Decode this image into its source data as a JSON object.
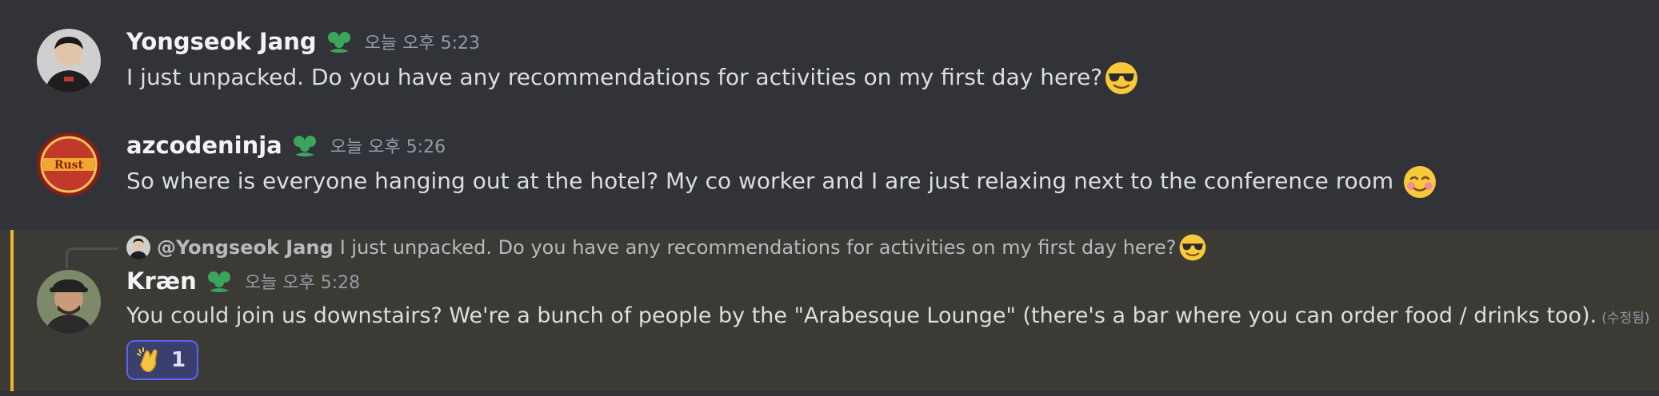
{
  "messages": [
    {
      "author": "Yongseok Jang",
      "timestamp": "오늘 오후 5:23",
      "text": "I just unpacked. Do you have any recommendations for activities on my first day here?",
      "emoji": "sunglasses-emoji"
    },
    {
      "author": "azcodeninja",
      "timestamp": "오늘 오후 5:26",
      "text": "So where is everyone hanging out at the hotel? My co worker and I are just relaxing next to the conference room ",
      "emoji": "smiling-face-emoji"
    },
    {
      "reply": {
        "author": "@Yongseok Jang",
        "text": "I just unpacked. Do you have any recommendations for activities on my first day here?",
        "emoji": "sunglasses-emoji"
      },
      "author": "Kræn",
      "timestamp": "오늘 오후 5:28",
      "text": "You could join us downstairs? We're a bunch of people by the \"Arabesque Lounge\" (there's a bar where you can order food / drinks too).",
      "edited": "(수정됨)",
      "reaction": {
        "emoji": "clapping-hands-emoji",
        "count": "1"
      }
    }
  ],
  "colors": {
    "background": "#313338",
    "mention_background": "#3c3a34",
    "mention_bar": "#f0b232",
    "username": "#f2f3f5",
    "text": "#dbdee1",
    "muted": "#949ba4",
    "clan_icon": "#3ba55d",
    "reaction_border": "#5865f2"
  }
}
